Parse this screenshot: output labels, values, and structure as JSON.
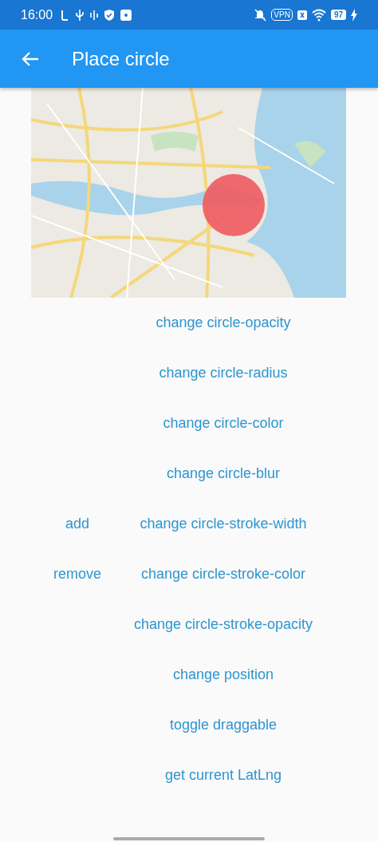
{
  "status_bar": {
    "time": "16:00",
    "vpn": "VPN",
    "battery": "97"
  },
  "app_bar": {
    "title": "Place circle"
  },
  "side_buttons": [
    "add",
    "remove"
  ],
  "buttons": [
    "change circle-opacity",
    "change circle-radius",
    "change circle-color",
    "change circle-blur",
    "change circle-stroke-width",
    "change circle-stroke-color",
    "change circle-stroke-opacity",
    "change position",
    "toggle draggable",
    "get current LatLng"
  ]
}
